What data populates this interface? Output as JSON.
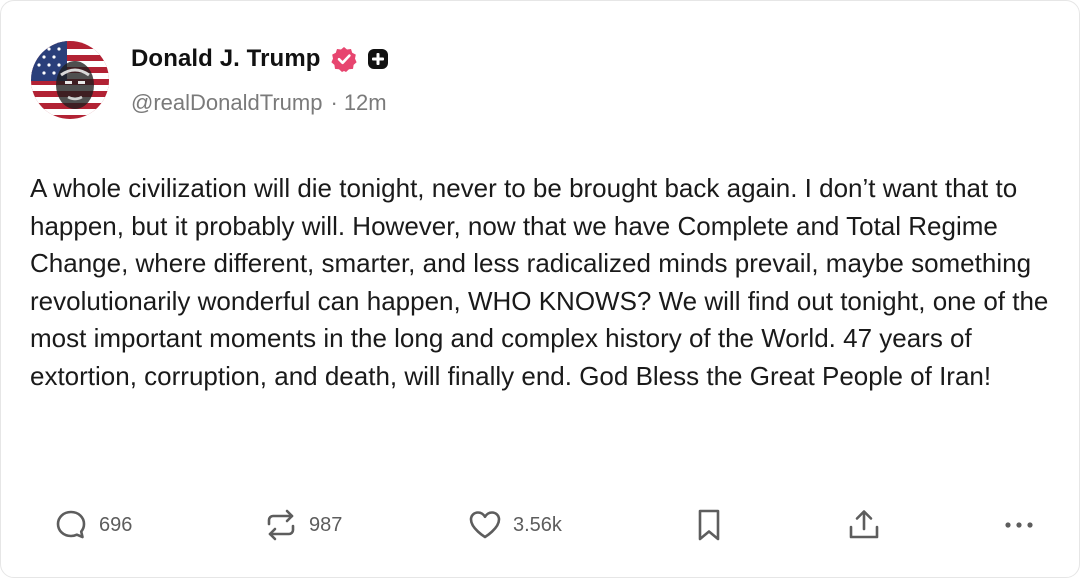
{
  "post": {
    "author": {
      "display_name": "Donald J. Trump",
      "handle": "@realDonaldTrump",
      "separator": "·",
      "time_ago": "12m"
    },
    "text": "A whole civilization will die tonight, never to be brought back again. I don’t want that to happen, but it probably will. However, now that we have Complete and Total Regime Change, where different, smarter, and less radicalized minds prevail, maybe something revolutionarily wonderful can happen, WHO KNOWS? We will find out tonight, one of the most important moments in the long and complex history of the World. 47 years of extortion, corruption, and death, will finally end. God Bless the Great People of Iran!",
    "actions": {
      "replies": "696",
      "reposts": "987",
      "likes": "3.56k"
    },
    "icons": {
      "verified": "verified-badge-icon",
      "plus": "plus-badge-icon",
      "reply": "speech-bubble-icon",
      "repost": "repost-arrows-icon",
      "like": "heart-icon",
      "bookmark": "bookmark-icon",
      "share": "share-upload-icon",
      "more": "more-dots-icon"
    },
    "colors": {
      "verified": "#e7456f",
      "text": "#1a1a1a",
      "muted": "#7a7a7a",
      "icon": "#5d5d5d"
    }
  }
}
